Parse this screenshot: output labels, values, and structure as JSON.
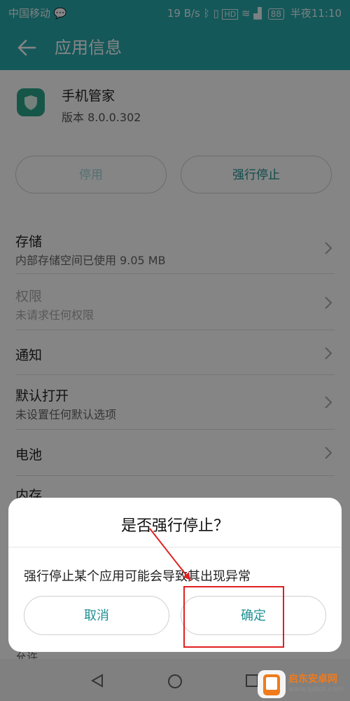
{
  "status_bar": {
    "carrier": "中国移动",
    "speed": "19 B/s",
    "hd": "HD",
    "battery": "88",
    "time": "半夜11:10"
  },
  "app_bar": {
    "title": "应用信息"
  },
  "app_info": {
    "name": "手机管家",
    "version": "版本 8.0.0.302"
  },
  "buttons": {
    "disable": "停用",
    "force_stop": "强行停止"
  },
  "rows": [
    {
      "title": "存储",
      "subtitle": "内部存储空间已使用 9.05 MB"
    },
    {
      "title": "权限",
      "subtitle": "未请求任何权限"
    },
    {
      "title": "通知",
      "subtitle": ""
    },
    {
      "title": "默认打开",
      "subtitle": "未设置任何默认选项"
    },
    {
      "title": "电池",
      "subtitle": ""
    },
    {
      "title": "内存",
      "subtitle": ""
    },
    {
      "title": "允许",
      "subtitle": ""
    }
  ],
  "dialog": {
    "title": "是否强行停止？",
    "message": "强行停止某个应用可能会导致其出现异常",
    "cancel": "取消",
    "confirm": "确定"
  },
  "watermark": {
    "name": "启东安卓网",
    "url": "www.qdtdt.com"
  },
  "colors": {
    "accent": "#2aa9ad",
    "button_text": "#1e8f93",
    "annotation": "#e02020"
  }
}
